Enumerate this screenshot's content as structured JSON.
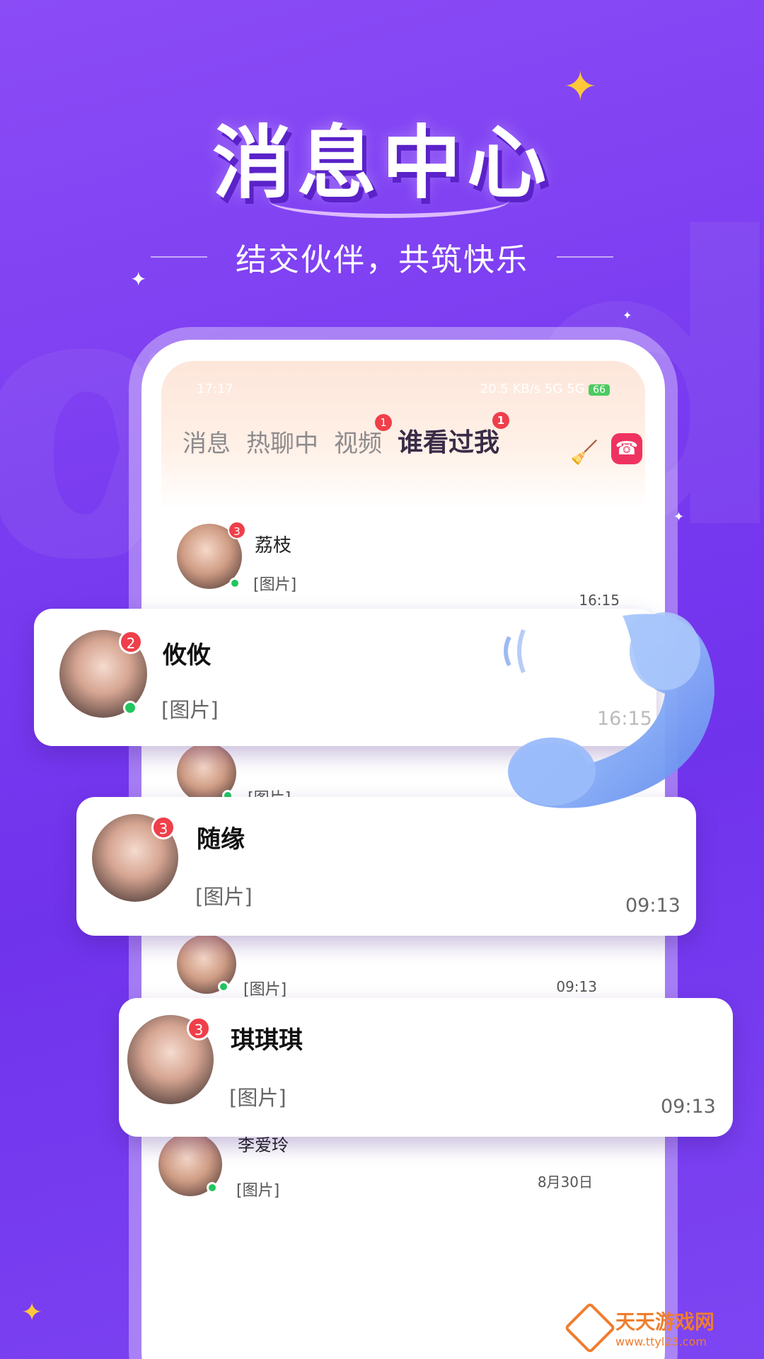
{
  "promo": {
    "headline": "消息中心",
    "tagline": "结交伙伴，共筑快乐"
  },
  "phone": {
    "status": {
      "time": "17:17",
      "speed": "20.5 KB/s",
      "network": "5G 5G",
      "battery": "66"
    },
    "tabs": [
      {
        "label": "消息",
        "badge": ""
      },
      {
        "label": "热聊中",
        "badge": ""
      },
      {
        "label": "视频",
        "badge": "1"
      },
      {
        "label": "谁看过我",
        "badge": "1"
      }
    ],
    "icons": [
      "broom-icon",
      "phone-call-icon"
    ],
    "conversations": [
      {
        "name": "荔枝",
        "preview": "[图片]",
        "time": "16:15",
        "unread": "3",
        "online": true
      },
      {
        "name": "攸攸",
        "preview": "[图片]",
        "time": "16:15",
        "unread": "2",
        "online": true
      },
      {
        "name": "",
        "preview": "[图片]",
        "time": "",
        "unread": "",
        "online": true
      },
      {
        "name": "随缘",
        "preview": "[图片]",
        "time": "09:13",
        "unread": "3",
        "online": false
      },
      {
        "name": "",
        "preview": "[图片]",
        "time": "09:13",
        "unread": "",
        "online": true
      },
      {
        "name": "琪琪琪",
        "preview": "[图片]",
        "time": "09:13",
        "unread": "3",
        "online": false
      },
      {
        "name": "李爱玲",
        "preview": "[图片]",
        "time": "8月30日",
        "unread": "",
        "online": true
      }
    ]
  },
  "watermark": {
    "title": "天天游戏网",
    "url": "www.ttyl23.com"
  },
  "colors": {
    "background": "#7a3cf0",
    "badge": "#ef3f4a",
    "online": "#22c55e",
    "sparkle": "#ffc83a"
  }
}
